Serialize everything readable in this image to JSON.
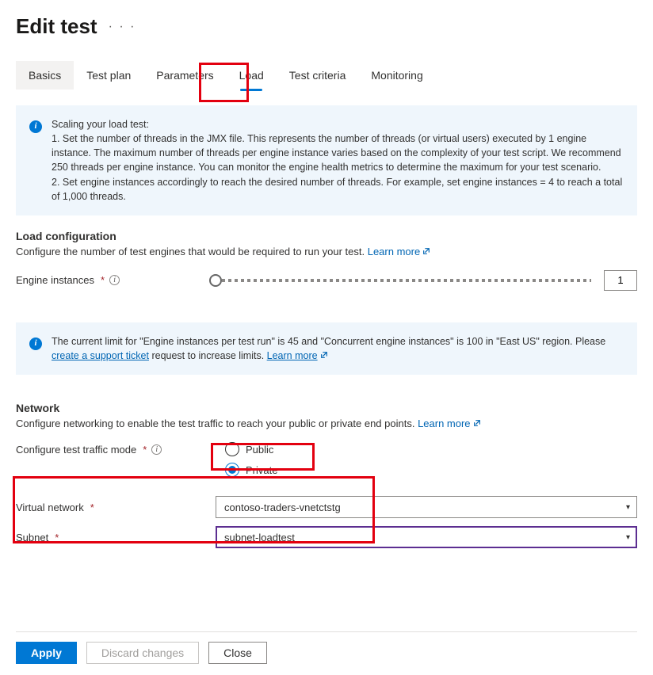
{
  "header": {
    "title": "Edit test",
    "more_icon_name": "more-icon"
  },
  "tabs": {
    "items": [
      {
        "label": "Basics"
      },
      {
        "label": "Test plan"
      },
      {
        "label": "Parameters"
      },
      {
        "label": "Load"
      },
      {
        "label": "Test criteria"
      },
      {
        "label": "Monitoring"
      }
    ],
    "active_index": 3
  },
  "scaling_info": {
    "heading": "Scaling your load test:",
    "line1": "1. Set the number of threads in the JMX file. This represents the number of threads (or virtual users) executed by 1 engine instance. The maximum number of threads per engine instance varies based on the complexity of your test script. We recommend 250 threads per engine instance. You can monitor the engine health metrics to determine the maximum for your test scenario.",
    "line2": "2. Set engine instances accordingly to reach the desired number of threads. For example, set engine instances = 4 to reach a total of 1,000 threads."
  },
  "load_config": {
    "title": "Load configuration",
    "desc_prefix": "Configure the number of test engines that would be required to run your test. ",
    "learn_more": "Learn more",
    "engine_label": "Engine instances",
    "engine_value": "1"
  },
  "limit_info": {
    "text_prefix": "The current limit for \"Engine instances per test run\" is 45 and \"Concurrent engine instances\" is 100 in \"East US\" region. Please ",
    "link1": "create a support ticket",
    "text_mid": " request to increase limits. ",
    "link2": "Learn more"
  },
  "network": {
    "title": "Network",
    "desc_prefix": "Configure networking to enable the test traffic to reach your public or private end points. ",
    "learn_more": "Learn more",
    "traffic_mode_label": "Configure test traffic mode",
    "options": {
      "public": "Public",
      "private": "Private"
    },
    "selected": "private",
    "vnet_label": "Virtual network",
    "vnet_value": "contoso-traders-vnetctstg",
    "subnet_label": "Subnet",
    "subnet_value": "subnet-loadtest"
  },
  "footer": {
    "apply": "Apply",
    "discard": "Discard changes",
    "close": "Close"
  }
}
